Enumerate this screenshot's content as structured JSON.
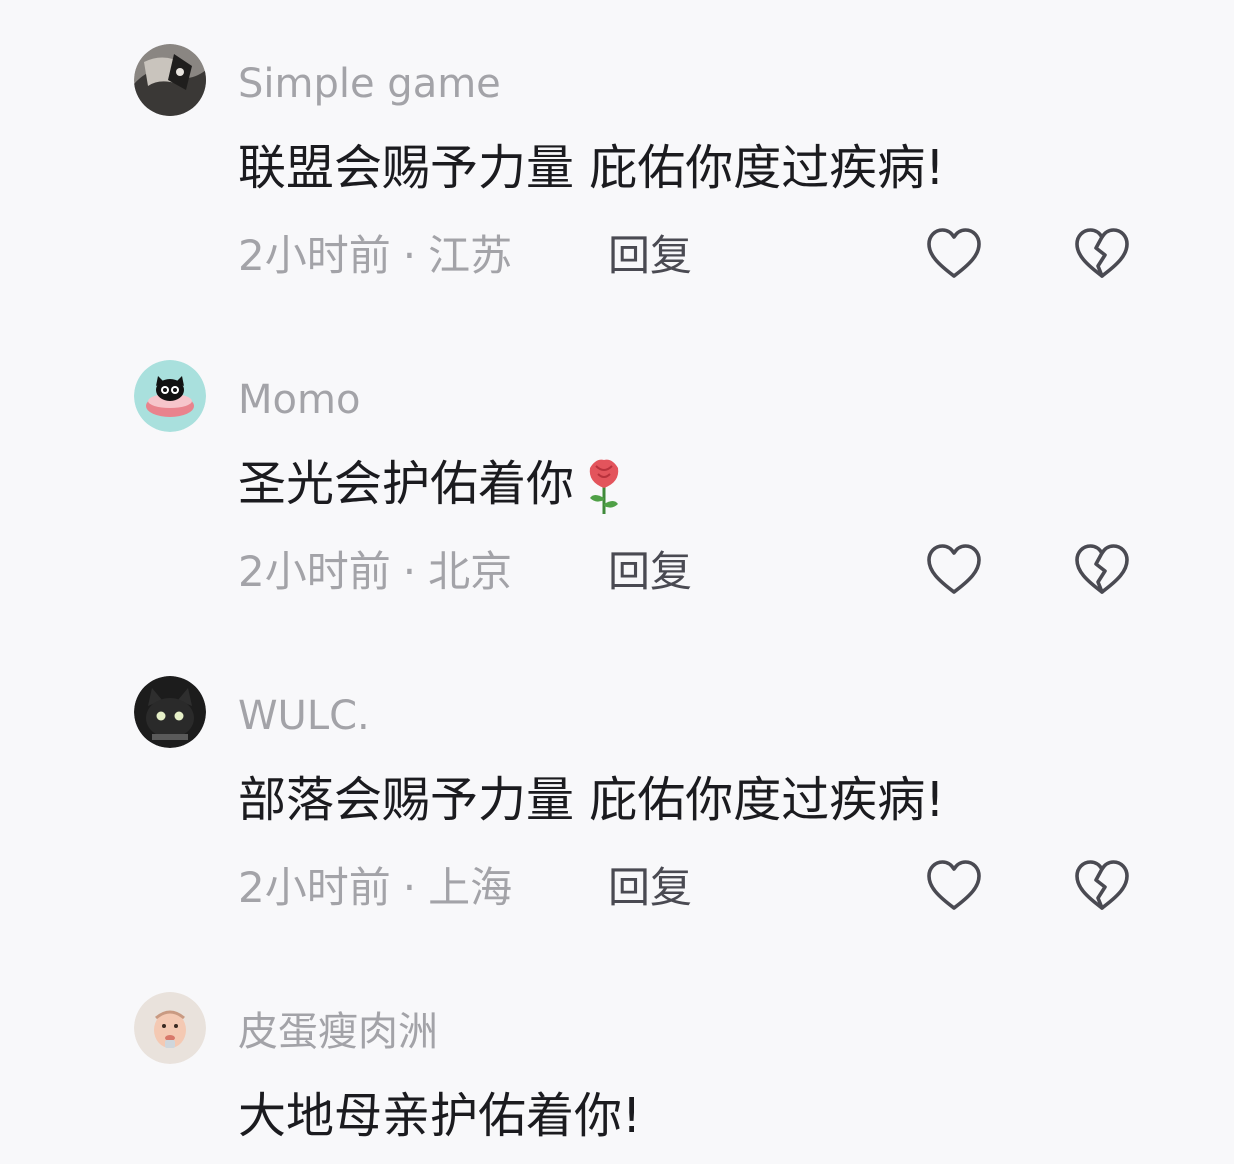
{
  "comments": [
    {
      "username": "Simple game",
      "text": "联盟会赐予力量 庇佑你度过疾病!",
      "time": "2小时前",
      "separator": "·",
      "location": "江苏",
      "reply_label": "回复",
      "avatar_icon": "dark-photo-avatar",
      "like_icon": "heart-outline-icon",
      "dislike_icon": "broken-heart-icon"
    },
    {
      "username": "Momo",
      "text": "圣光会护佑着你",
      "emoji_icon": "rose-icon",
      "time": "2小时前",
      "separator": "·",
      "location": "北京",
      "reply_label": "回复",
      "avatar_icon": "cat-cake-avatar",
      "like_icon": "heart-outline-icon",
      "dislike_icon": "broken-heart-icon"
    },
    {
      "username": "WULC.",
      "text": "部落会赐予力量 庇佑你度过疾病!",
      "time": "2小时前",
      "separator": "·",
      "location": "上海",
      "reply_label": "回复",
      "avatar_icon": "black-cat-avatar",
      "like_icon": "heart-outline-icon",
      "dislike_icon": "broken-heart-icon"
    },
    {
      "username": "皮蛋瘦肉洲",
      "text": "大地母亲护佑着你!",
      "avatar_icon": "baby-face-avatar"
    }
  ],
  "colors": {
    "background": "#f8f8fa",
    "username": "#a3a3a8",
    "content": "#1b1b1f",
    "meta": "#a3a3a8",
    "reply": "#4a4a52",
    "icon_stroke": "#4a4a52"
  }
}
